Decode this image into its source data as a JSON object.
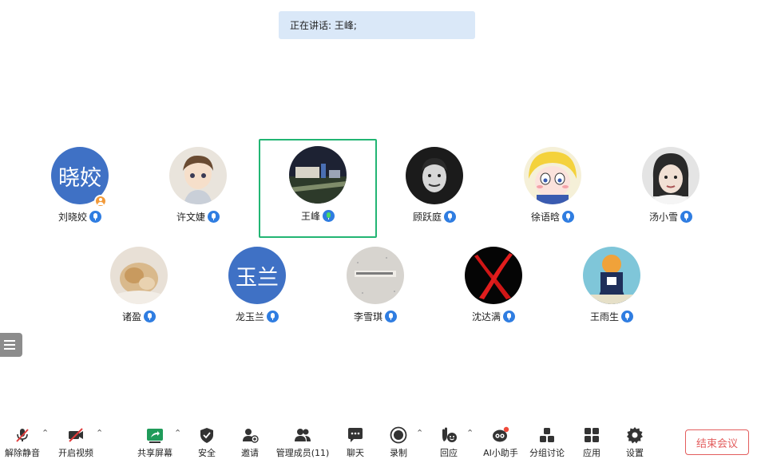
{
  "speaking_bar": {
    "text": "正在讲话: 王峰;"
  },
  "participants": [
    {
      "name": "刘晓姣",
      "avatar_text": "晓姣",
      "host": true
    },
    {
      "name": "许文婕"
    },
    {
      "name": "王峰",
      "speaking": true
    },
    {
      "name": "顾跃庭"
    },
    {
      "name": "徐语晗"
    },
    {
      "name": "汤小雪"
    },
    {
      "name": "诸盈"
    },
    {
      "name": "龙玉兰",
      "avatar_text": "玉兰"
    },
    {
      "name": "李雪琪"
    },
    {
      "name": "沈达满"
    },
    {
      "name": "王雨生"
    }
  ],
  "toolbar": {
    "unmute": "解除静音",
    "start_video": "开启视频",
    "share_screen": "共享屏幕",
    "security": "安全",
    "invite": "邀请",
    "manage_members": "管理成员(11)",
    "chat": "聊天",
    "record": "录制",
    "respond": "回应",
    "ai_assistant": "AI小助手",
    "breakout": "分组讨论",
    "apps": "应用",
    "settings": "设置",
    "end_meeting": "结束会议"
  },
  "colors": {
    "accent": "#2f7de1",
    "speaking_border": "#22b573",
    "end_red": "#e35d5d",
    "avatar_blue": "#3f71c5"
  }
}
